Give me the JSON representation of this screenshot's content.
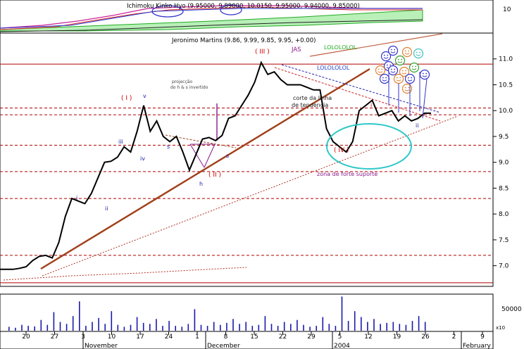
{
  "top_panel": {
    "title": "Ichimoku Kinko Hyo (9.95000, 9.89000, 10.0150, 9.95000, 9.94000, 9.85000)",
    "axis_label": "10"
  },
  "main_panel": {
    "title": "Jeronimo Martins (9.86, 9.99, 9.85, 9.95, +0.00)"
  },
  "volume_panel": {
    "axis_label": "50000",
    "multiplier": "x10"
  },
  "annotations": {
    "wave_i_roman": "( I )",
    "wave_ii_roman": "( II )",
    "wave_iii_roman": "( III )",
    "wave_iv_roman": "( IV )",
    "jas": "JAS",
    "lol1": "LOLOLOLOL",
    "lol2": "LOLOLOLOL",
    "projection": "projecção",
    "projection2": "do h & s invertido",
    "corte1": "corte da linha",
    "corte2": "de tendencia",
    "suporte": "zona de forte suporte",
    "w_i": "i",
    "w_ii": "ii",
    "w_iii": "iii",
    "w_iv": "iv",
    "w_v": "v",
    "w_s1": "s",
    "w_h": "h",
    "w_s2": "s",
    "w_i2": "i",
    "w_ii2": "ii"
  },
  "colors": {
    "price": "#000000",
    "trend": "#a0401a",
    "channel": "#c06040",
    "dashed": "#b00000",
    "ellipse": "#30c8c8",
    "wave": "#cc0000",
    "minor": "#1a1aaa",
    "volume": "#1a1aaa",
    "smiley_blue": "#3333cc",
    "smiley_orange": "#e08030",
    "smiley_green": "#30a030",
    "smiley_cyan": "#40c0c0"
  },
  "chart_data": [
    {
      "type": "line",
      "title": "Jeronimo Martins (9.86, 9.99, 9.85, 9.95, +0.00)",
      "xlabel": "",
      "ylabel": "",
      "ylim": [
        6.6,
        11.5
      ],
      "y_ticks": [
        7.0,
        7.5,
        8.0,
        8.5,
        9.0,
        9.5,
        10.0,
        10.5,
        11.0
      ],
      "y_tick_labels": [
        "7.0",
        "7.5",
        "8.0",
        "8.5",
        "9.0",
        "9.5",
        "10.0",
        "10.5",
        "11.0"
      ],
      "x_tick_labels": [
        "20",
        "27",
        "3",
        "10",
        "17",
        "24",
        "1",
        "8",
        "15",
        "22",
        "29",
        "5",
        "12",
        "19",
        "26",
        "2",
        "9"
      ],
      "month_labels": [
        "November",
        "December",
        "2004",
        "February"
      ],
      "x": [
        "Oct-14",
        "Oct-17",
        "Oct-20",
        "Oct-22",
        "Oct-24",
        "Oct-27",
        "Oct-28",
        "Oct-29",
        "Oct-30",
        "Oct-31",
        "Nov-03",
        "Nov-04",
        "Nov-05",
        "Nov-06",
        "Nov-07",
        "Nov-10",
        "Nov-11",
        "Nov-12",
        "Nov-13",
        "Nov-14",
        "Nov-17",
        "Nov-18",
        "Nov-19",
        "Nov-20",
        "Nov-21",
        "Nov-24",
        "Nov-25",
        "Nov-26",
        "Nov-27",
        "Nov-28",
        "Dec-01",
        "Dec-02",
        "Dec-03",
        "Dec-04",
        "Dec-05",
        "Dec-08",
        "Dec-09",
        "Dec-10",
        "Dec-11",
        "Dec-12",
        "Dec-15",
        "Dec-16",
        "Dec-17",
        "Dec-18",
        "Dec-19",
        "Dec-22",
        "Dec-24",
        "Dec-26",
        "Dec-29",
        "Dec-30",
        "Jan-02",
        "Jan-05",
        "Jan-06",
        "Jan-07",
        "Jan-08",
        "Jan-09",
        "Jan-12",
        "Jan-13",
        "Jan-14",
        "Jan-15",
        "Jan-16",
        "Jan-19",
        "Jan-20",
        "Jan-21",
        "Jan-22",
        "Jan-23",
        "Jan-26"
      ],
      "series": [
        {
          "values": [
            6.93,
            6.93,
            6.93,
            6.95,
            6.98,
            7.1,
            7.18,
            7.2,
            7.15,
            7.45,
            7.95,
            8.3,
            8.25,
            8.2,
            8.4,
            8.7,
            9.0,
            9.02,
            9.1,
            9.3,
            9.2,
            9.6,
            10.1,
            9.6,
            9.8,
            9.5,
            9.4,
            9.5,
            9.2,
            8.85,
            9.15,
            9.45,
            9.48,
            9.42,
            9.52,
            9.85,
            9.9,
            10.1,
            10.3,
            10.55,
            10.93,
            10.7,
            10.75,
            10.6,
            10.5,
            10.5,
            10.5,
            10.45,
            10.4,
            10.4,
            9.65,
            9.4,
            9.3,
            9.2,
            9.4,
            10.0,
            10.1,
            10.2,
            9.9,
            9.95,
            10.0,
            9.8,
            9.9,
            9.8,
            9.85,
            9.95,
            9.95
          ]
        }
      ],
      "horizontal_lines": [
        10.9,
        10.05,
        9.92,
        9.33,
        8.82,
        8.3,
        7.2,
        6.67
      ]
    },
    {
      "type": "bar",
      "title": "",
      "ylabel": "",
      "y_tick_labels": [
        "50000"
      ],
      "multiplier": "x10",
      "values": [
        8,
        6,
        12,
        10,
        9,
        22,
        12,
        38,
        18,
        14,
        30,
        60,
        10,
        18,
        26,
        14,
        40,
        12,
        8,
        12,
        28,
        16,
        14,
        24,
        10,
        20,
        10,
        8,
        14,
        44,
        12,
        10,
        18,
        12,
        16,
        24,
        14,
        18,
        10,
        12,
        30,
        14,
        10,
        18,
        14,
        22,
        12,
        8,
        10,
        28,
        14,
        10,
        70,
        20,
        40,
        28,
        18,
        24,
        14,
        16,
        18,
        14,
        12,
        20,
        30,
        18
      ]
    }
  ]
}
